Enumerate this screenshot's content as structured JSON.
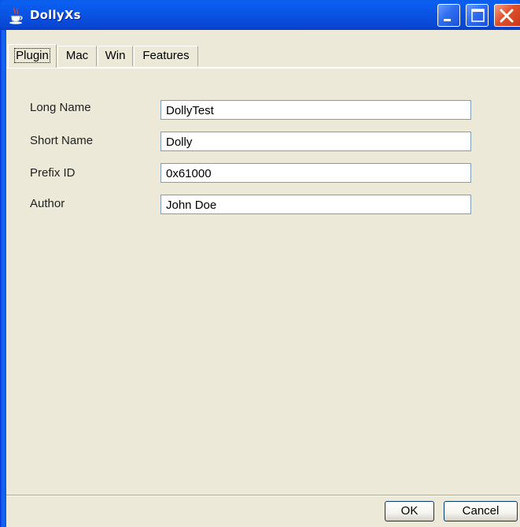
{
  "window": {
    "title": "DollyXs",
    "icon": "java-coffee-cup-icon"
  },
  "title_buttons": {
    "minimize_icon": "minimize-icon",
    "maximize_icon": "maximize-icon",
    "close_icon": "close-icon"
  },
  "tabs": [
    {
      "label": "Plugin",
      "active": true
    },
    {
      "label": "Mac",
      "active": false
    },
    {
      "label": "Win",
      "active": false
    },
    {
      "label": "Features",
      "active": false
    }
  ],
  "fields": [
    {
      "label": "Long Name",
      "value": "DollyTest"
    },
    {
      "label": "Short Name",
      "value": "Dolly"
    },
    {
      "label": "Prefix ID",
      "value": "0x61000"
    },
    {
      "label": "Author",
      "value": "John Doe"
    }
  ],
  "buttons": {
    "ok": "OK",
    "cancel": "Cancel"
  },
  "colors": {
    "titlebar": "#0a52e2",
    "client_bg": "#ece9d8",
    "close_button": "#e0502c"
  }
}
